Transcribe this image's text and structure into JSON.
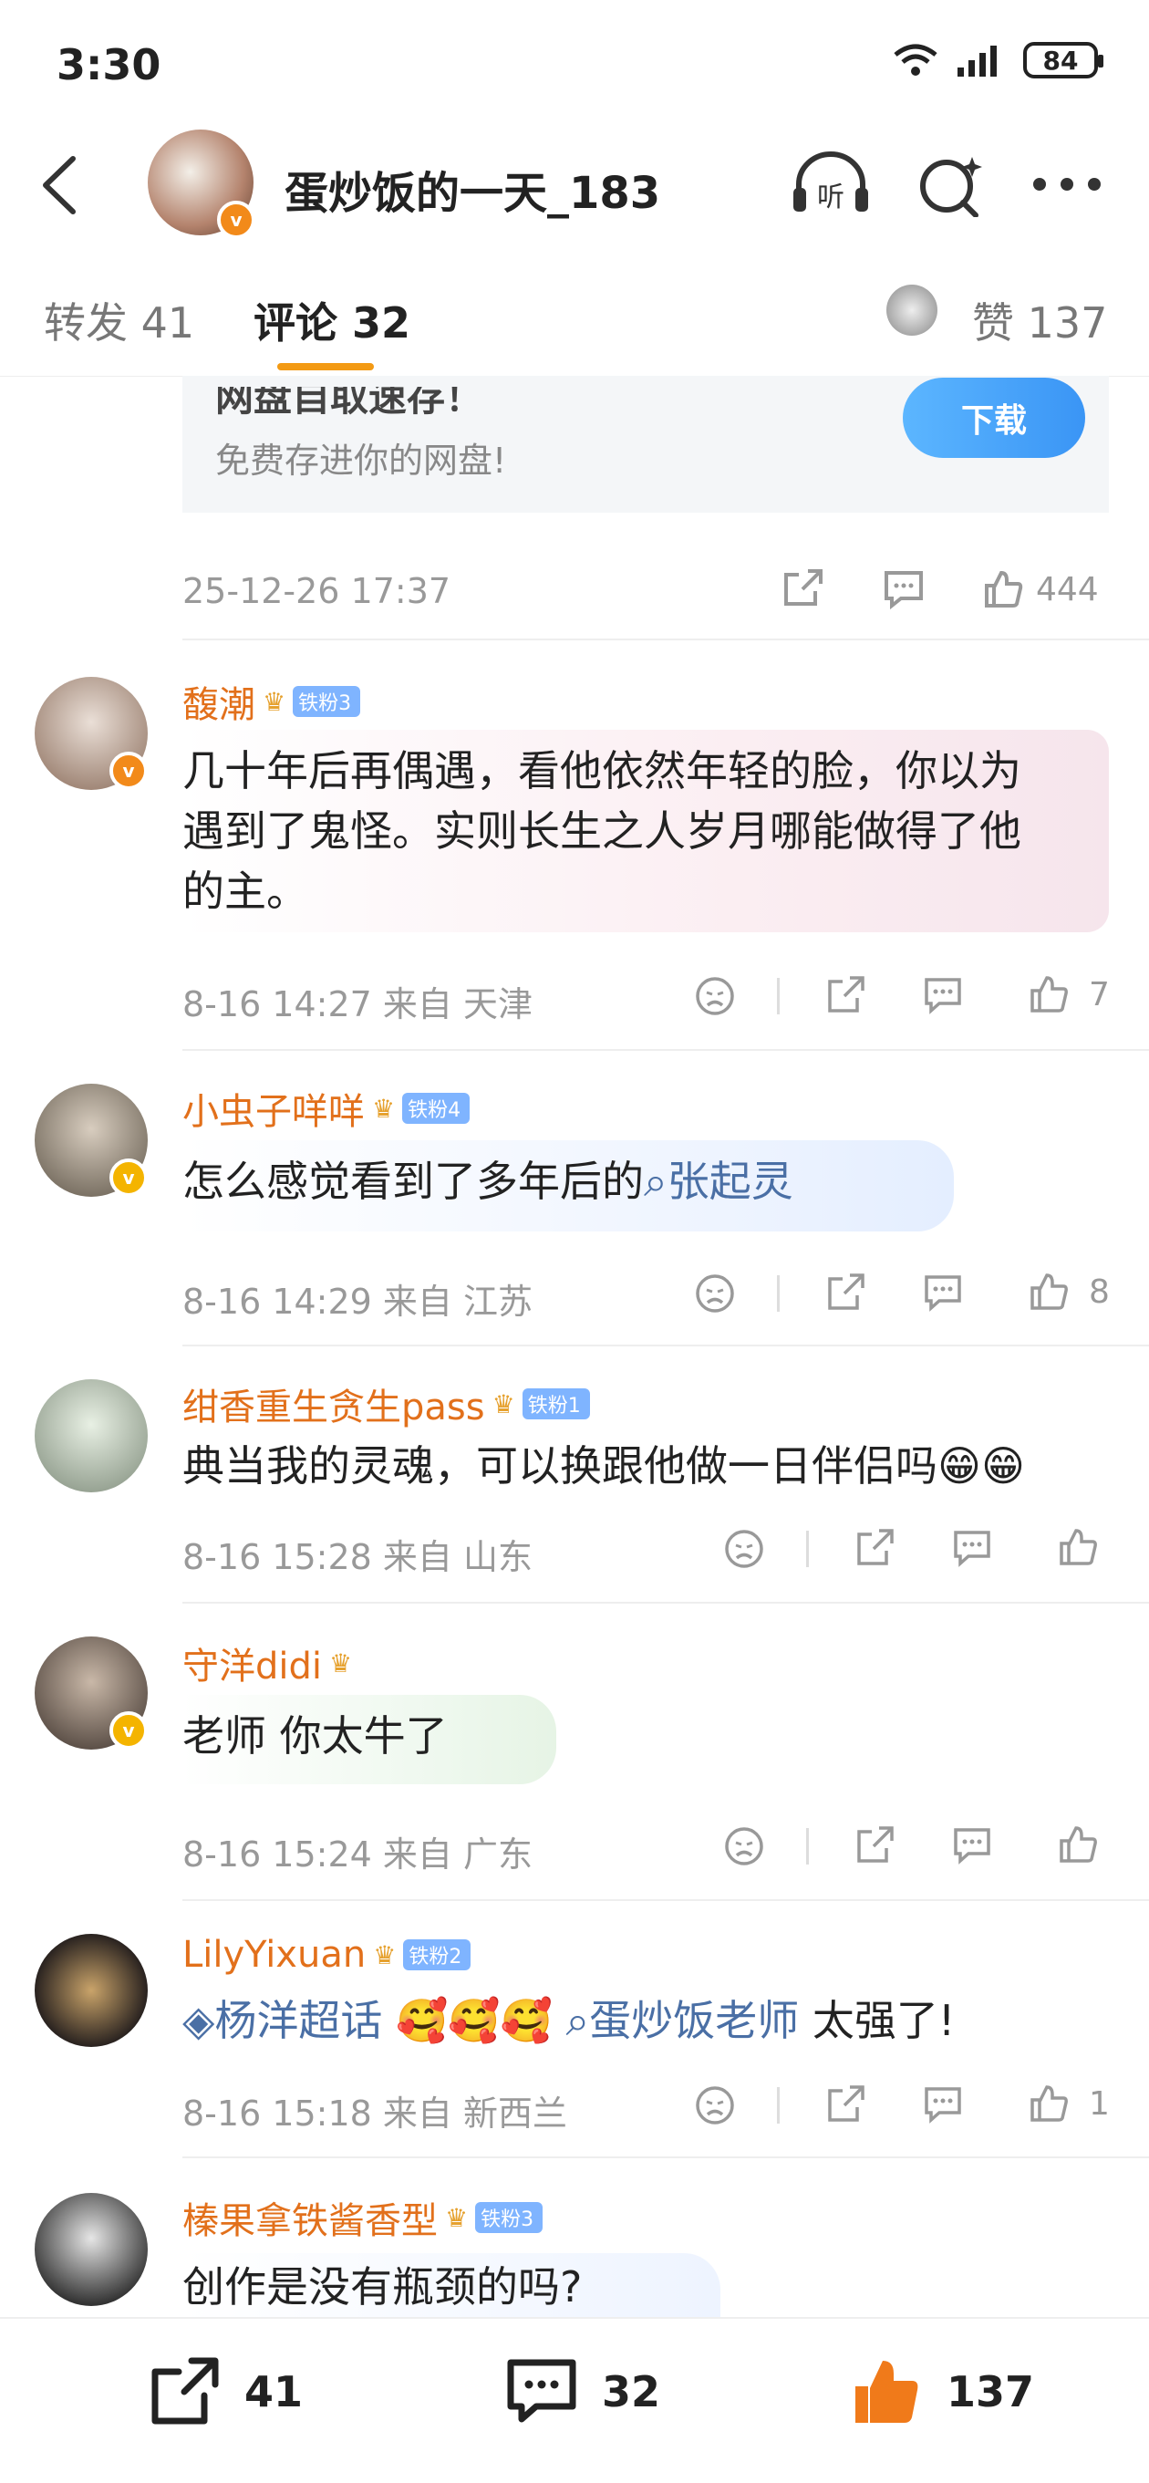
{
  "status": {
    "time": "3:30",
    "battery": "84"
  },
  "header": {
    "title": "蛋炒饭的一天_183",
    "listen_label": "听"
  },
  "tabs": {
    "repost": "转发 41",
    "comments": "评论 32",
    "likes": "赞 137"
  },
  "ad": {
    "title": "网盘自取速存！",
    "subtitle": "免费存进你的网盘!",
    "download": "下载"
  },
  "post": {
    "time": "25-12-26 17:37",
    "likes": "444"
  },
  "comments": [
    {
      "name": "馥潮",
      "fan": "铁粉3",
      "text_lines": [
        "几十年后再偶遇，看他依然年轻的脸，你以为",
        "遇到了鬼怪。实则长生之人岁月哪能做得了他",
        "的主。"
      ],
      "meta": "8-16 14:27  来自 天津",
      "likes": "7"
    },
    {
      "name": "小虫子咩咩",
      "fan": "铁粉4",
      "text": "怎么感觉看到了多年后的",
      "link": "张起灵",
      "meta": "8-16 14:29  来自 江苏",
      "likes": "8"
    },
    {
      "name": "绀香重生贪生pass",
      "fan": "铁粉1",
      "text": "典当我的灵魂，可以换跟他做一日伴侣吗😁😁",
      "meta": "8-16 15:28  来自 山东",
      "likes": ""
    },
    {
      "name": "守洋didi",
      "fan": "",
      "text": "老师 你太牛了",
      "meta": "8-16 15:24  来自 广东",
      "likes": ""
    },
    {
      "name": "LilyYixuan",
      "fan": "铁粉2",
      "link1": "杨洋超话",
      "emojis": "🥰🥰🥰",
      "link2": "蛋炒饭老师",
      "text_end": " 太强了!",
      "meta": "8-16 15:18  来自 新西兰",
      "likes": "1"
    },
    {
      "name": "榛果拿铁酱香型",
      "fan": "铁粉3",
      "text": "创作是没有瓶颈的吗?"
    }
  ],
  "bottom": {
    "reposts": "41",
    "comments": "32",
    "likes": "137"
  },
  "colors": {
    "accent": "#f39a14",
    "name": "#e2701b",
    "link": "#4a6fa5",
    "like_orange": "#f07a1a"
  }
}
